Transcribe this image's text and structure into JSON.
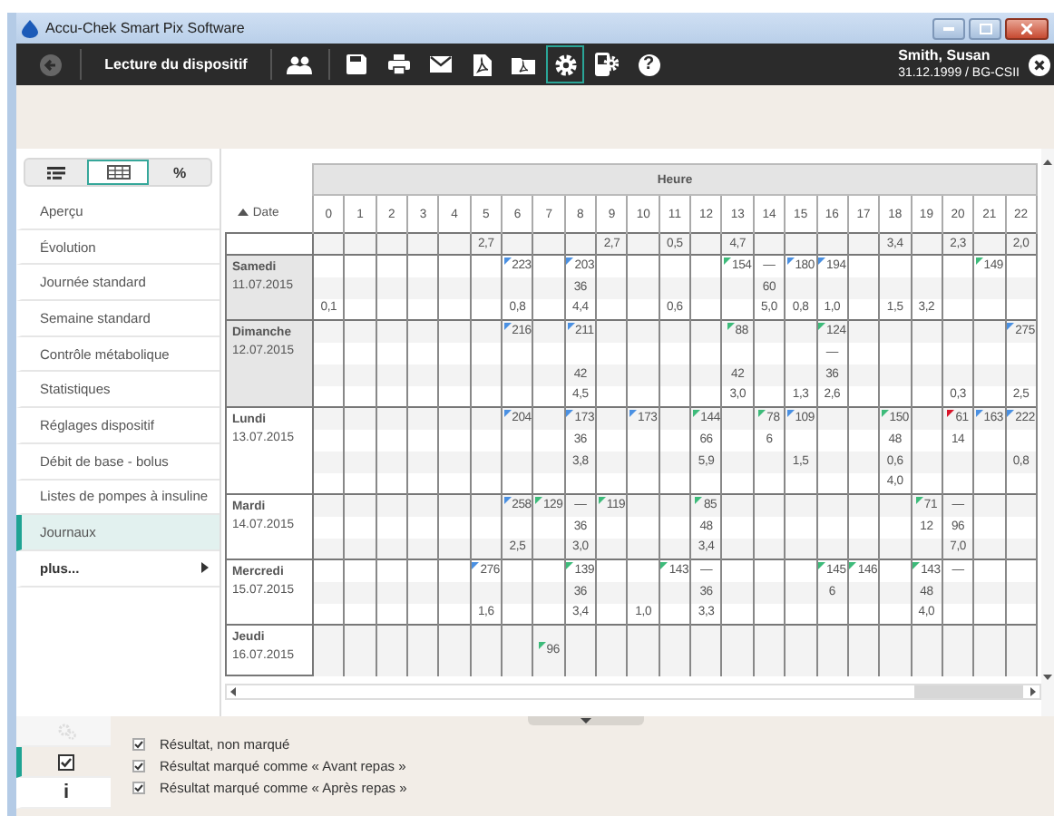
{
  "window": {
    "title": "Accu-Chek Smart Pix Software"
  },
  "toolbar": {
    "title": "Lecture du dispositif",
    "tools": [
      {
        "kind": "users",
        "selected": false
      },
      {
        "kind": "save",
        "selected": false
      },
      {
        "kind": "print",
        "selected": false
      },
      {
        "kind": "mail",
        "selected": false
      },
      {
        "kind": "pdf",
        "selected": false
      },
      {
        "kind": "pdf-folder",
        "selected": false
      },
      {
        "kind": "settings",
        "selected": true
      },
      {
        "kind": "device-settings",
        "selected": false
      },
      {
        "kind": "help",
        "label": "?",
        "selected": false
      }
    ]
  },
  "patient": {
    "name": "Smith, Susan",
    "details": "31.12.1999 / BG-CSII"
  },
  "view_toggles": [
    {
      "kind": "list",
      "selected": false
    },
    {
      "kind": "table",
      "selected": true
    },
    {
      "kind": "percent",
      "label": "%",
      "selected": false
    }
  ],
  "sidebar": {
    "items": [
      {
        "label": "Aperçu",
        "selected": false,
        "submenu": false
      },
      {
        "label": "Évolution",
        "selected": false,
        "submenu": false
      },
      {
        "label": "Journée standard",
        "selected": false,
        "submenu": false
      },
      {
        "label": "Semaine standard",
        "selected": false,
        "submenu": false
      },
      {
        "label": "Contrôle métabolique",
        "selected": false,
        "submenu": false
      },
      {
        "label": "Statistiques",
        "selected": false,
        "submenu": false
      },
      {
        "label": "Réglages dispositif",
        "selected": false,
        "submenu": false
      },
      {
        "label": "Débit de base - bolus",
        "selected": false,
        "submenu": false
      },
      {
        "label": "Listes de pompes à insuline",
        "selected": false,
        "submenu": false
      },
      {
        "label": "Journaux",
        "selected": true,
        "submenu": false
      },
      {
        "label": "plus...",
        "selected": false,
        "submenu": true
      }
    ]
  },
  "table": {
    "group_header": "Heure",
    "date_header": "Date",
    "hours": [
      "0",
      "1",
      "2",
      "3",
      "4",
      "5",
      "6",
      "7",
      "8",
      "9",
      "10",
      "11",
      "12",
      "13",
      "14",
      "15",
      "16",
      "17",
      "18",
      "19",
      "20",
      "21",
      "22"
    ],
    "days": [
      {
        "shaded": false,
        "lines": [
          {
            "h5": {
              "text": "2,7"
            },
            "h9": {
              "text": "2,7"
            },
            "h11": {
              "text": "0,5"
            },
            "h13": {
              "text": "4,7"
            },
            "h18": {
              "text": "3,4"
            },
            "h20": {
              "text": "2,3"
            },
            "h22": {
              "text": "2,0"
            }
          }
        ]
      },
      {
        "weekday": "Samedi",
        "date": "11.07.2015",
        "shaded": true,
        "lines": [
          {
            "h6": {
              "text": "223",
              "color": "#4a90e2"
            },
            "h8": {
              "text": "203",
              "color": "#4a90e2"
            },
            "h13": {
              "text": "154",
              "color": "#3dbb7a"
            },
            "h14": {
              "text": "—"
            },
            "h15": {
              "text": "180",
              "color": "#4a90e2"
            },
            "h16": {
              "text": "194",
              "color": "#4a90e2"
            },
            "h21": {
              "text": "149",
              "color": "#3dbb7a"
            }
          },
          {
            "h8": {
              "text": "36"
            },
            "h14": {
              "text": "60"
            }
          },
          {
            "h0": {
              "text": "0,1"
            },
            "h6": {
              "text": "0,8"
            },
            "h8": {
              "text": "4,4"
            },
            "h11": {
              "text": "0,6"
            },
            "h14": {
              "text": "5,0"
            },
            "h15": {
              "text": "0,8"
            },
            "h16": {
              "text": "1,0"
            },
            "h18": {
              "text": "1,5"
            },
            "h19": {
              "text": "3,2"
            }
          }
        ]
      },
      {
        "weekday": "Dimanche",
        "date": "12.07.2015",
        "shaded": true,
        "lines": [
          {
            "h6": {
              "text": "216",
              "color": "#4a90e2"
            },
            "h8": {
              "text": "211",
              "color": "#4a90e2"
            },
            "h13": {
              "text": "88",
              "color": "#3dbb7a"
            },
            "h16": {
              "text": "124",
              "color": "#3dbb7a"
            },
            "h22": {
              "text": "275",
              "color": "#4a90e2"
            }
          },
          {
            "h16": {
              "text": "—"
            }
          },
          {
            "h8": {
              "text": "42"
            },
            "h13": {
              "text": "42"
            },
            "h16": {
              "text": "36"
            }
          },
          {
            "h8": {
              "text": "4,5"
            },
            "h13": {
              "text": "3,0"
            },
            "h15": {
              "text": "1,3"
            },
            "h16": {
              "text": "2,6"
            },
            "h20": {
              "text": "0,3"
            },
            "h22": {
              "text": "2,5"
            }
          }
        ]
      },
      {
        "weekday": "Lundi",
        "date": "13.07.2015",
        "shaded": false,
        "lines": [
          {
            "h6": {
              "text": "204",
              "color": "#4a90e2"
            },
            "h8": {
              "text": "173",
              "color": "#4a90e2"
            },
            "h10": {
              "text": "173",
              "color": "#4a90e2"
            },
            "h12": {
              "text": "144",
              "color": "#3dbb7a"
            },
            "h14": {
              "text": "78",
              "color": "#3dbb7a"
            },
            "h15": {
              "text": "109",
              "color": "#4a90e2"
            },
            "h18": {
              "text": "150",
              "color": "#3dbb7a"
            },
            "h20": {
              "text": "61",
              "color": "#d9142a"
            },
            "h21": {
              "text": "163",
              "color": "#4a90e2"
            },
            "h22": {
              "text": "222",
              "color": "#4a90e2"
            }
          },
          {
            "h8": {
              "text": "36"
            },
            "h12": {
              "text": "66"
            },
            "h14": {
              "text": "6"
            },
            "h18": {
              "text": "48"
            },
            "h20": {
              "text": "14"
            }
          },
          {
            "h8": {
              "text": "3,8"
            },
            "h12": {
              "text": "5,9"
            },
            "h15": {
              "text": "1,5"
            },
            "h18": {
              "text": "0,6"
            },
            "h22": {
              "text": "0,8"
            }
          },
          {
            "h18": {
              "text": "4,0"
            }
          }
        ]
      },
      {
        "weekday": "Mardi",
        "date": "14.07.2015",
        "shaded": false,
        "lines": [
          {
            "h6": {
              "text": "258",
              "color": "#4a90e2"
            },
            "h7": {
              "text": "129",
              "color": "#3dbb7a"
            },
            "h8": {
              "text": "—"
            },
            "h9": {
              "text": "119",
              "color": "#3dbb7a"
            },
            "h12": {
              "text": "85",
              "color": "#3dbb7a"
            },
            "h19": {
              "text": "71",
              "color": "#3dbb7a"
            },
            "h20": {
              "text": "—"
            }
          },
          {
            "h8": {
              "text": "36"
            },
            "h12": {
              "text": "48"
            },
            "h19": {
              "text": "12"
            },
            "h20": {
              "text": "96"
            }
          },
          {
            "h6": {
              "text": "2,5"
            },
            "h8": {
              "text": "3,0"
            },
            "h12": {
              "text": "3,4"
            },
            "h20": {
              "text": "7,0"
            }
          }
        ]
      },
      {
        "weekday": "Mercredi",
        "date": "15.07.2015",
        "shaded": false,
        "lines": [
          {
            "h5": {
              "text": "276",
              "color": "#4a90e2"
            },
            "h8": {
              "text": "139",
              "color": "#3dbb7a"
            },
            "h11": {
              "text": "143",
              "color": "#3dbb7a"
            },
            "h12": {
              "text": "—"
            },
            "h16": {
              "text": "145",
              "color": "#3dbb7a"
            },
            "h17": {
              "text": "146",
              "color": "#3dbb7a"
            },
            "h19": {
              "text": "143",
              "color": "#3dbb7a"
            },
            "h20": {
              "text": "—"
            }
          },
          {
            "h8": {
              "text": "36"
            },
            "h12": {
              "text": "36"
            },
            "h16": {
              "text": "6"
            },
            "h19": {
              "text": "48"
            }
          },
          {
            "h5": {
              "text": "1,6"
            },
            "h8": {
              "text": "3,4"
            },
            "h10": {
              "text": "1,0"
            },
            "h12": {
              "text": "3,3"
            },
            "h19": {
              "text": "4,0"
            }
          }
        ]
      },
      {
        "weekday": "Jeudi",
        "date": "16.07.2015",
        "shaded": false,
        "lines": [
          {
            "h7": {
              "text": "96",
              "color": "#3dbb7a"
            }
          }
        ]
      }
    ]
  },
  "bottom_tabs": [
    {
      "kind": "settings",
      "disabled": true,
      "selected": false
    },
    {
      "kind": "legend",
      "disabled": false,
      "selected": true
    },
    {
      "kind": "info",
      "label": "i",
      "disabled": false,
      "selected": false
    }
  ],
  "legend": [
    {
      "text": "Résultat, non marqué",
      "checked": true
    },
    {
      "text": "Résultat marqué comme « Avant repas »",
      "checked": true
    },
    {
      "text": "Résultat marqué comme « Après repas »",
      "checked": true
    }
  ]
}
